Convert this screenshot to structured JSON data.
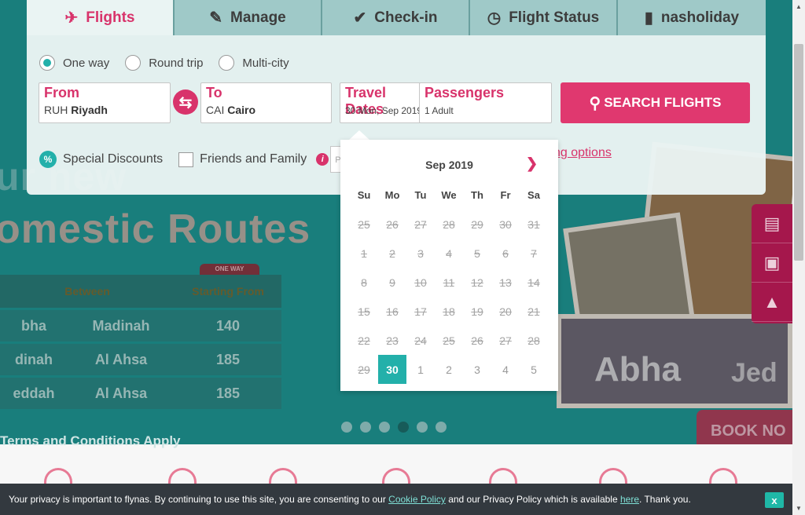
{
  "tabs": [
    {
      "label": "Flights",
      "icon": "plane-icon",
      "active": true
    },
    {
      "label": "Manage",
      "icon": "edit-icon",
      "active": false
    },
    {
      "label": "Check-in",
      "icon": "check-icon",
      "active": false
    },
    {
      "label": "Flight Status",
      "icon": "clock-icon",
      "active": false
    },
    {
      "label": "nasholiday",
      "icon": "luggage-icon",
      "active": false
    }
  ],
  "trip_types": {
    "one_way": "One way",
    "round_trip": "Round trip",
    "multi_city": "Multi-city",
    "selected": "one_way"
  },
  "from": {
    "label": "From",
    "code": "RUH",
    "city": "Riyadh"
  },
  "to": {
    "label": "To",
    "code": "CAI",
    "city": "Cairo"
  },
  "dates": {
    "label": "Travel Dates",
    "value": "30 Mon, Sep 2019"
  },
  "passengers": {
    "label": "Passengers",
    "value": "1 Adult"
  },
  "search": {
    "label": "SEARCH FLIGHTS"
  },
  "discounts": {
    "special": "Special Discounts",
    "friends": "Friends and Family",
    "promo_placeholder": "Pr",
    "more_options": "ng options"
  },
  "calendar": {
    "month": "Sep 2019",
    "weekdays": [
      "Su",
      "Mo",
      "Tu",
      "We",
      "Th",
      "Fr",
      "Sa"
    ],
    "weeks": [
      [
        "25",
        "26",
        "27",
        "28",
        "29",
        "30",
        "31"
      ],
      [
        "1",
        "2",
        "3",
        "4",
        "5",
        "6",
        "7"
      ],
      [
        "8",
        "9",
        "10",
        "11",
        "12",
        "13",
        "14"
      ],
      [
        "15",
        "16",
        "17",
        "18",
        "19",
        "20",
        "21"
      ],
      [
        "22",
        "23",
        "24",
        "25",
        "26",
        "27",
        "28"
      ],
      [
        "29",
        "30",
        "1",
        "2",
        "3",
        "4",
        "5"
      ]
    ],
    "selected": "30"
  },
  "hero": {
    "line1": "ur new",
    "line2": "omestic Routes",
    "badge": "ONE WAY",
    "col1": "Between",
    "col2": "Starting From",
    "rows": [
      [
        "bha",
        "Madinah",
        "140"
      ],
      [
        "dinah",
        "Al Ahsa",
        "185"
      ],
      [
        "eddah",
        "Al Ahsa",
        "185"
      ]
    ],
    "abha": "Abha",
    "jeddah": "Jed",
    "book_now": "BOOK NO",
    "terms": "Terms and Conditions Apply"
  },
  "cookie": {
    "text1": "Your privacy is important to flynas. By continuing to use this site, you are consenting to our ",
    "link1": "Cookie Policy",
    "text2": " and our Privacy Policy which is available ",
    "link2": "here",
    "text3": ". Thank you.",
    "close": "x"
  },
  "colors": {
    "brand": "#d8336b",
    "accent": "#23b0aa"
  }
}
